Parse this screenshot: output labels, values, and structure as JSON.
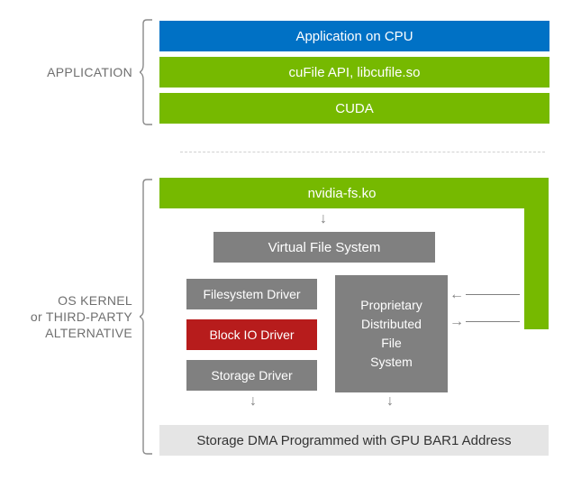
{
  "section1_label": "APPLICATION",
  "section2_label_line1": "OS KERNEL",
  "section2_label_line2": "or THIRD-PARTY",
  "section2_label_line3": "ALTERNATIVE",
  "app_cpu": "Application on CPU",
  "cufile": "cuFile API, libcufile.so",
  "cuda": "CUDA",
  "nvidiafs": "nvidia-fs.ko",
  "vfs": "Virtual File System",
  "fs_driver": "Filesystem Driver",
  "block_io": "Block IO Driver",
  "storage_driver": "Storage Driver",
  "dfs_line1": "Proprietary",
  "dfs_line2": "Distributed",
  "dfs_line3": "File",
  "dfs_line4": "System",
  "dma": "Storage DMA Programmed with GPU BAR1 Address",
  "chart_data": {
    "type": "diagram",
    "title": "GPUDirect Storage software stack",
    "groups": [
      {
        "label": "APPLICATION",
        "layers": [
          {
            "name": "Application on CPU",
            "color": "#0071c5"
          },
          {
            "name": "cuFile API, libcufile.so",
            "color": "#76b900"
          },
          {
            "name": "CUDA",
            "color": "#76b900"
          }
        ]
      },
      {
        "label": "OS KERNEL or THIRD-PARTY ALTERNATIVE",
        "layers": [
          {
            "name": "nvidia-fs.ko",
            "color": "#76b900"
          },
          {
            "name": "Virtual File System",
            "color": "#808080"
          },
          {
            "name": "Filesystem Driver",
            "color": "#808080",
            "column": "left"
          },
          {
            "name": "Block IO Driver",
            "color": "#b71c1c",
            "column": "left"
          },
          {
            "name": "Storage Driver",
            "color": "#808080",
            "column": "left"
          },
          {
            "name": "Proprietary Distributed File System",
            "color": "#808080",
            "column": "right"
          },
          {
            "name": "Storage DMA Programmed with GPU BAR1 Address",
            "color": "#e5e5e5"
          }
        ],
        "flows": [
          [
            "nvidia-fs.ko",
            "Virtual File System"
          ],
          [
            "Virtual File System",
            "Filesystem Driver"
          ],
          [
            "Virtual File System",
            "Proprietary Distributed File System"
          ],
          [
            "nvidia-fs.ko",
            "Proprietary Distributed File System"
          ],
          [
            "Storage Driver",
            "Storage DMA Programmed with GPU BAR1 Address"
          ],
          [
            "Proprietary Distributed File System",
            "Storage DMA Programmed with GPU BAR1 Address"
          ]
        ]
      }
    ]
  }
}
